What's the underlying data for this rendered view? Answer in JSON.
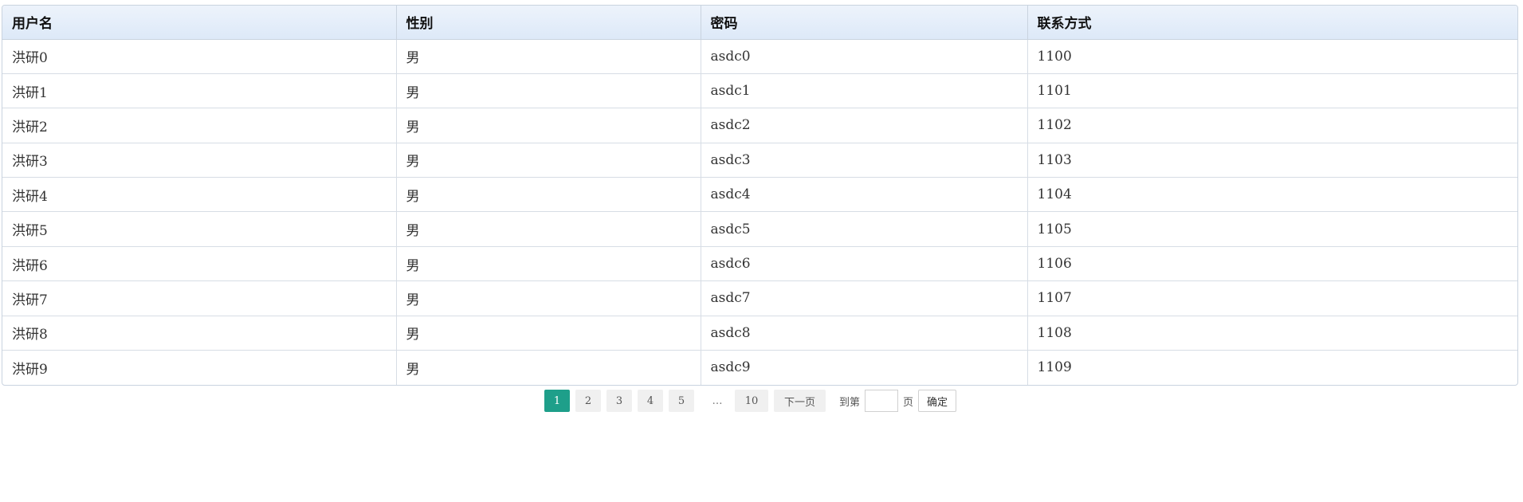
{
  "table": {
    "headers": [
      "用户名",
      "性别",
      "密码",
      "联系方式"
    ],
    "rows": [
      [
        "洪研0",
        "男",
        "asdc0",
        "1100"
      ],
      [
        "洪研1",
        "男",
        "asdc1",
        "1101"
      ],
      [
        "洪研2",
        "男",
        "asdc2",
        "1102"
      ],
      [
        "洪研3",
        "男",
        "asdc3",
        "1103"
      ],
      [
        "洪研4",
        "男",
        "asdc4",
        "1104"
      ],
      [
        "洪研5",
        "男",
        "asdc5",
        "1105"
      ],
      [
        "洪研6",
        "男",
        "asdc6",
        "1106"
      ],
      [
        "洪研7",
        "男",
        "asdc7",
        "1107"
      ],
      [
        "洪研8",
        "男",
        "asdc8",
        "1108"
      ],
      [
        "洪研9",
        "男",
        "asdc9",
        "1109"
      ]
    ]
  },
  "pagination": {
    "pages": [
      "1",
      "2",
      "3",
      "4",
      "5"
    ],
    "current": "1",
    "ellipsis": "…",
    "last": "10",
    "next_label": "下一页",
    "goto_label": "到第",
    "page_unit": "页",
    "goto_value": "",
    "confirm_label": "确定",
    "colors": {
      "active_bg": "#1e9f8a",
      "button_bg": "#f0f0f0"
    }
  }
}
